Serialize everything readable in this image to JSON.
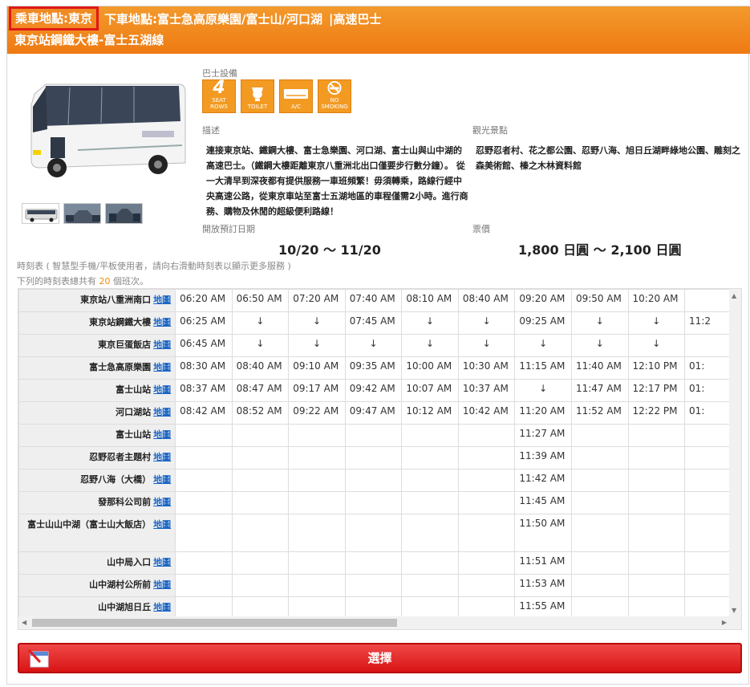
{
  "header": {
    "origin": "乘車地點:東京",
    "destination": "下車地點:富士急高原樂園/富士山/河口湖",
    "bus_type": "|高速巴士",
    "route": "東京站鋼鐵大樓-富士五湖線"
  },
  "facilities": {
    "label": "巴士設備",
    "items": [
      {
        "big": "4",
        "text": "SEAT ROWS",
        "icon": "four-seat-rows-icon"
      },
      {
        "big": "",
        "text": "TOILET",
        "icon": "toilet-icon"
      },
      {
        "big": "",
        "text": "A/C",
        "icon": "air-conditioner-icon"
      },
      {
        "big": "",
        "text": "NO SMOKING",
        "icon": "no-smoking-icon"
      }
    ]
  },
  "description": {
    "label": "描述",
    "text": "連接東京站、鐵鋼大樓、富士急樂園、河口湖、富士山與山中湖的高速巴士。（鐵鋼大樓距離東京八重洲北出口僅要步行數分鐘）。 從一大清早到深夜都有提供服務一車班頻繁！毋須轉乘，路線行經中央高速公路，從東京車站至富士五湖地區的車程僅需2小時。進行商務、購物及休閒的超級便利路線！"
  },
  "sightseeing": {
    "label": "觀光景點",
    "text": "忍野忍者村、花之都公園、忍野八海、旭日丘湖畔綠地公園、雕刻之森美術館、榛之木林資料館"
  },
  "booking": {
    "label": "開放預訂日期",
    "value": "10/20 ～ 11/20"
  },
  "price": {
    "label": "票價",
    "value": "1,800 日圓 ～ 2,100 日圓"
  },
  "timetable": {
    "note": "時刻表 ( 智慧型手機/平板使用者，請向右滑動時刻表以顯示更多服務 )",
    "count_prefix": "下列的時刻表總共有 ",
    "count": "20",
    "count_suffix": " 個班次。",
    "map_label": "地圖",
    "rows": [
      {
        "stop": "東京站八重洲南口",
        "times": [
          "06:20 AM",
          "06:50 AM",
          "07:20 AM",
          "07:40 AM",
          "08:10 AM",
          "08:40 AM",
          "09:20 AM",
          "09:50 AM",
          "10:20 AM",
          ""
        ]
      },
      {
        "stop": "東京站鋼鐵大樓",
        "times": [
          "06:25 AM",
          "↓",
          "↓",
          "07:45 AM",
          "↓",
          "↓",
          "09:25 AM",
          "↓",
          "↓",
          "11:2"
        ]
      },
      {
        "stop": "東京巨蛋飯店",
        "times": [
          "06:45 AM",
          "↓",
          "↓",
          "↓",
          "↓",
          "↓",
          "↓",
          "↓",
          "↓",
          ""
        ]
      },
      {
        "stop": "富士急高原樂園",
        "times": [
          "08:30 AM",
          "08:40 AM",
          "09:10 AM",
          "09:35 AM",
          "10:00 AM",
          "10:30 AM",
          "11:15 AM",
          "11:40 AM",
          "12:10 PM",
          "01:"
        ]
      },
      {
        "stop": "富士山站",
        "times": [
          "08:37 AM",
          "08:47 AM",
          "09:17 AM",
          "09:42 AM",
          "10:07 AM",
          "10:37 AM",
          "↓",
          "11:47 AM",
          "12:17 PM",
          "01:"
        ]
      },
      {
        "stop": "河口湖站",
        "times": [
          "08:42 AM",
          "08:52 AM",
          "09:22 AM",
          "09:47 AM",
          "10:12 AM",
          "10:42 AM",
          "11:20 AM",
          "11:52 AM",
          "12:22 PM",
          "01:"
        ]
      },
      {
        "stop": "富士山站",
        "times": [
          "",
          "",
          "",
          "",
          "",
          "",
          "11:27 AM",
          "",
          "",
          ""
        ]
      },
      {
        "stop": "忍野忍者主題村",
        "times": [
          "",
          "",
          "",
          "",
          "",
          "",
          "11:39 AM",
          "",
          "",
          ""
        ]
      },
      {
        "stop": "忍野八海（大橋）",
        "times": [
          "",
          "",
          "",
          "",
          "",
          "",
          "11:42 AM",
          "",
          "",
          ""
        ]
      },
      {
        "stop": "發那科公司前",
        "times": [
          "",
          "",
          "",
          "",
          "",
          "",
          "11:45 AM",
          "",
          "",
          ""
        ]
      },
      {
        "stop": "富士山山中湖（富士山大飯店）",
        "times": [
          "",
          "",
          "",
          "",
          "",
          "",
          "11:50 AM",
          "",
          "",
          ""
        ],
        "tall": true
      },
      {
        "stop": "山中局入口",
        "times": [
          "",
          "",
          "",
          "",
          "",
          "",
          "11:51 AM",
          "",
          "",
          ""
        ]
      },
      {
        "stop": "山中湖村公所前",
        "times": [
          "",
          "",
          "",
          "",
          "",
          "",
          "11:53 AM",
          "",
          "",
          ""
        ]
      },
      {
        "stop": "山中湖旭日丘",
        "times": [
          "",
          "",
          "",
          "",
          "",
          "",
          "11:55 AM",
          "",
          "",
          ""
        ]
      }
    ]
  },
  "select_button": {
    "label": "選擇",
    "icon": "calendar-icon"
  },
  "colors": {
    "accent": "#ee7a12",
    "button": "#d81414",
    "link": "#1a66c6"
  }
}
